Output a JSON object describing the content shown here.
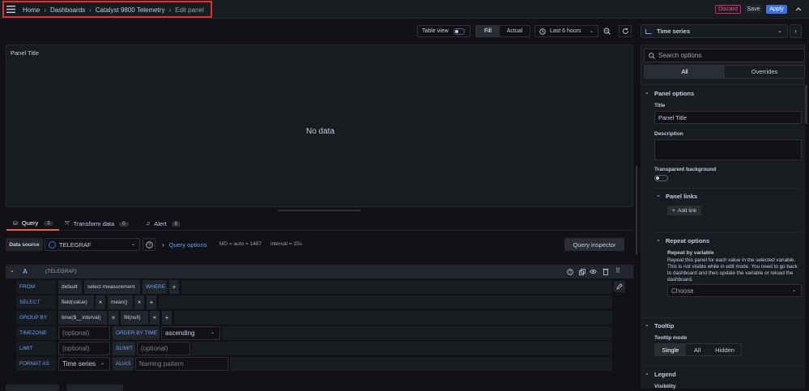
{
  "topbar": {
    "breadcrumb": [
      "Home",
      "Dashboards",
      "Catalyst 9800 Telemetry",
      "Edit panel"
    ],
    "discard_label": "Discard",
    "save_label": "Save",
    "apply_label": "Apply"
  },
  "toolbar": {
    "table_view_label": "Table view",
    "fill_label": "Fill",
    "actual_label": "Actual",
    "time_range_label": "Last 6 hours"
  },
  "panel": {
    "title": "Panel Title",
    "no_data": "No data"
  },
  "query_tabs": [
    {
      "label": "Query",
      "count": "1"
    },
    {
      "label": "Transform data",
      "count": "0"
    },
    {
      "label": "Alert",
      "count": "0"
    }
  ],
  "datasource": {
    "label": "Data source",
    "value": "TELEGRAF",
    "query_options_label": "Query options",
    "md_text": "MD = auto = 1487",
    "interval_text": "interval = 15s",
    "inspector_label": "Query inspector"
  },
  "query": {
    "ref": "A",
    "ds_name": "(TELEGRAF)",
    "from_kw": "FROM",
    "from_policy": "default",
    "from_measurement": "select measurement",
    "where_kw": "WHERE",
    "select_kw": "SELECT",
    "select_field": "field(value)",
    "select_fn": "mean()",
    "groupby_kw": "GROUP BY",
    "groupby_time": "time($__interval)",
    "groupby_fill": "fill(null)",
    "timezone_kw": "TIMEZONE",
    "timezone_placeholder": "(optional)",
    "orderby_kw": "ORDER BY TIME",
    "orderby_value": "ascending",
    "limit_kw": "LIMIT",
    "limit_placeholder": "(optional)",
    "slimit_kw": "SLIMIT",
    "slimit_placeholder": "(optional)",
    "formatas_kw": "FORMAT AS",
    "formatas_value": "Time series",
    "alias_kw": "ALIAS",
    "alias_placeholder": "Naming pattern",
    "plus": "+",
    "x": "×"
  },
  "options": {
    "viz_label": "Time series",
    "search_placeholder": "Search options",
    "tabs": [
      "All",
      "Overrides"
    ],
    "panel_options_label": "Panel options",
    "title_label": "Title",
    "title_value": "Panel Title",
    "description_label": "Description",
    "transparent_label": "Transparent background",
    "panel_links_label": "Panel links",
    "add_link_label": "Add link",
    "repeat_options_label": "Repeat options",
    "repeat_by_label": "Repeat by variable",
    "repeat_desc": "Repeat this panel for each value in the selected variable. This is not visible while in edit mode. You need to go back to dashboard and then update the variable or reload the dashboard.",
    "choose_placeholder": "Choose",
    "tooltip_label": "Tooltip",
    "tooltip_mode_label": "Tooltip mode",
    "tooltip_modes": [
      "Single",
      "All",
      "Hidden"
    ],
    "legend_label": "Legend",
    "visibility_label": "Visibility"
  },
  "colors": {
    "background": "#111217",
    "panel": "#181b1f",
    "accent_blue": "#3d71d9",
    "link_blue": "#6e9fff",
    "discard_red": "#e0226e",
    "active_tab": "#f55f3e",
    "highlight_box": "#e02f2f"
  }
}
